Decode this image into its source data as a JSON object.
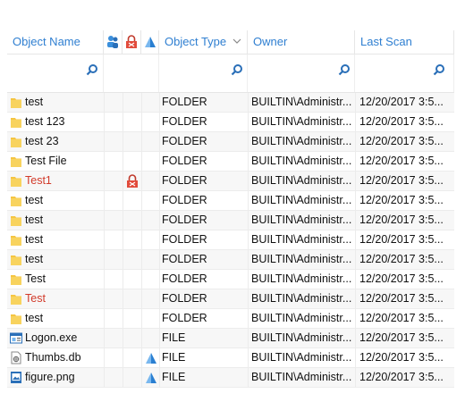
{
  "columns": {
    "name": "Object Name",
    "type": "Object Type",
    "owner": "Owner",
    "scan": "Last Scan"
  },
  "header_icons": [
    "user-group-icon",
    "lock-icon",
    "triangle-icon"
  ],
  "colors": {
    "header_text": "#2f7fd1",
    "highlight_text": "#d23a2a",
    "folder": "#f5c542"
  },
  "rows": [
    {
      "name": "test",
      "type": "FOLDER",
      "owner": "BUILTIN\\Administr...",
      "scan": "12/20/2017 3:5...",
      "icon": "folder-icon",
      "red": false,
      "lock": false,
      "tri": false
    },
    {
      "name": "test 123",
      "type": "FOLDER",
      "owner": "BUILTIN\\Administr...",
      "scan": "12/20/2017 3:5...",
      "icon": "folder-icon",
      "red": false,
      "lock": false,
      "tri": false
    },
    {
      "name": "test 23",
      "type": "FOLDER",
      "owner": "BUILTIN\\Administr...",
      "scan": "12/20/2017 3:5...",
      "icon": "folder-icon",
      "red": false,
      "lock": false,
      "tri": false
    },
    {
      "name": "Test File",
      "type": "FOLDER",
      "owner": "BUILTIN\\Administr...",
      "scan": "12/20/2017 3:5...",
      "icon": "folder-icon",
      "red": false,
      "lock": false,
      "tri": false
    },
    {
      "name": "Test1",
      "type": "FOLDER",
      "owner": "BUILTIN\\Administr...",
      "scan": "12/20/2017 3:5...",
      "icon": "folder-icon",
      "red": true,
      "lock": true,
      "tri": false
    },
    {
      "name": "test",
      "type": "FOLDER",
      "owner": "BUILTIN\\Administr...",
      "scan": "12/20/2017 3:5...",
      "icon": "folder-icon",
      "red": false,
      "lock": false,
      "tri": false
    },
    {
      "name": "test",
      "type": "FOLDER",
      "owner": "BUILTIN\\Administr...",
      "scan": "12/20/2017 3:5...",
      "icon": "folder-icon",
      "red": false,
      "lock": false,
      "tri": false
    },
    {
      "name": "test",
      "type": "FOLDER",
      "owner": "BUILTIN\\Administr...",
      "scan": "12/20/2017 3:5...",
      "icon": "folder-icon",
      "red": false,
      "lock": false,
      "tri": false
    },
    {
      "name": "test",
      "type": "FOLDER",
      "owner": "BUILTIN\\Administr...",
      "scan": "12/20/2017 3:5...",
      "icon": "folder-icon",
      "red": false,
      "lock": false,
      "tri": false
    },
    {
      "name": "Test",
      "type": "FOLDER",
      "owner": "BUILTIN\\Administr...",
      "scan": "12/20/2017 3:5...",
      "icon": "folder-icon",
      "red": false,
      "lock": false,
      "tri": false
    },
    {
      "name": "Test",
      "type": "FOLDER",
      "owner": "BUILTIN\\Administr...",
      "scan": "12/20/2017 3:5...",
      "icon": "folder-icon",
      "red": true,
      "lock": false,
      "tri": false
    },
    {
      "name": "test",
      "type": "FOLDER",
      "owner": "BUILTIN\\Administr...",
      "scan": "12/20/2017 3:5...",
      "icon": "folder-icon",
      "red": false,
      "lock": false,
      "tri": false
    },
    {
      "name": "Logon.exe",
      "type": "FILE",
      "owner": "BUILTIN\\Administr...",
      "scan": "12/20/2017 3:5...",
      "icon": "exe-file-icon",
      "red": false,
      "lock": false,
      "tri": false
    },
    {
      "name": "Thumbs.db",
      "type": "FILE",
      "owner": "BUILTIN\\Administr...",
      "scan": "12/20/2017 3:5...",
      "icon": "db-file-icon",
      "red": false,
      "lock": false,
      "tri": true
    },
    {
      "name": "figure.png",
      "type": "FILE",
      "owner": "BUILTIN\\Administr...",
      "scan": "12/20/2017 3:5...",
      "icon": "image-file-icon",
      "red": false,
      "lock": false,
      "tri": true
    }
  ]
}
